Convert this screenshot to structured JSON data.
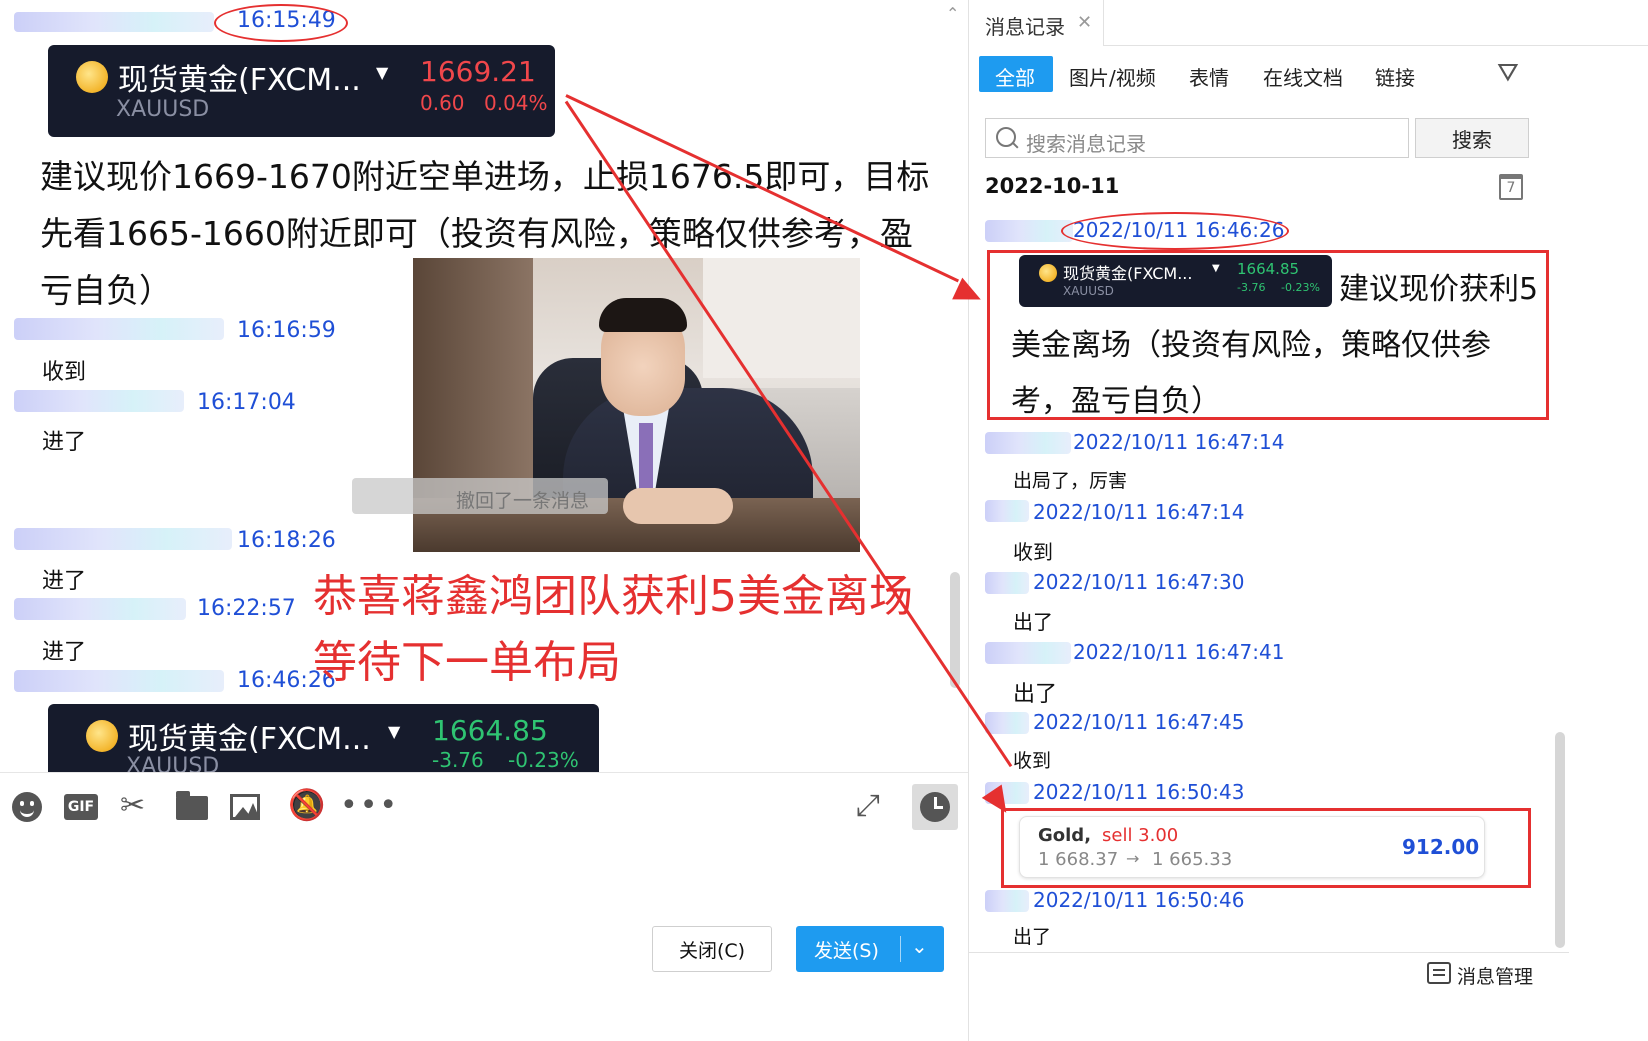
{
  "chat": {
    "messages": [
      {
        "time": "16:15:49"
      },
      {
        "time": "16:16:59",
        "text": "收到"
      },
      {
        "time": "16:17:04",
        "text": "进了"
      },
      {
        "time": "16:18:26",
        "text": "进了"
      },
      {
        "time": "16:22:57",
        "text": "进了"
      },
      {
        "time": "16:46:26"
      }
    ],
    "ticker1": {
      "name": "现货黄金(FXCM...",
      "symbol": "XAUUSD",
      "price": "1669.21",
      "change": "0.60",
      "pct": "0.04%"
    },
    "ticker2": {
      "name": "现货黄金(FXCM...",
      "symbol": "XAUUSD",
      "price": "1664.85",
      "change": "-3.76",
      "pct": "-0.23%"
    },
    "advice": "建议现价1669-1670附近空单进场，止损1676.5即可，目标先看1665-1660附近即可（投资有风险，策略仅供参考，盈亏自负）",
    "recalled": "撤回了一条消息",
    "caption_line1": "恭喜蒋鑫鸿团队获利5美金离场",
    "caption_line2": "等待下一单布局"
  },
  "input": {
    "close_label": "关闭(C)",
    "send_label": "发送(S)"
  },
  "history": {
    "tab_title": "消息记录",
    "filters": [
      "全部",
      "图片/视频",
      "表情",
      "在线文档",
      "链接"
    ],
    "search_placeholder": "搜索消息记录",
    "search_button": "搜索",
    "date": "2022-10-11",
    "calendar_day": "7",
    "entries": [
      {
        "time": "2022/10/11 16:46:26"
      },
      {
        "time": "2022/10/11 16:47:14",
        "text": "出局了，厉害"
      },
      {
        "time": "2022/10/11 16:47:14",
        "text": "收到"
      },
      {
        "time": "2022/10/11 16:47:30",
        "text": "出了"
      },
      {
        "time": "2022/10/11 16:47:41",
        "text": "出了"
      },
      {
        "time": "2022/10/11 16:47:45",
        "text": "收到"
      },
      {
        "time": "2022/10/11 16:50:43"
      },
      {
        "time": "2022/10/11 16:50:46",
        "text": "出了"
      }
    ],
    "ticker": {
      "name": "现货黄金(FXCM...",
      "symbol": "XAUUSD",
      "price": "1664.85",
      "change": "-3.76",
      "pct": "-0.23%"
    },
    "profit_text": "建议现价获利5美金离场（投资有风险，策略仅供参考，盈亏自负）",
    "trade": {
      "instrument": "Gold,",
      "side": "sell 3.00",
      "from": "1 668.37",
      "to": "1 665.33",
      "profit": "912.00"
    },
    "manage_label": "消息管理"
  }
}
